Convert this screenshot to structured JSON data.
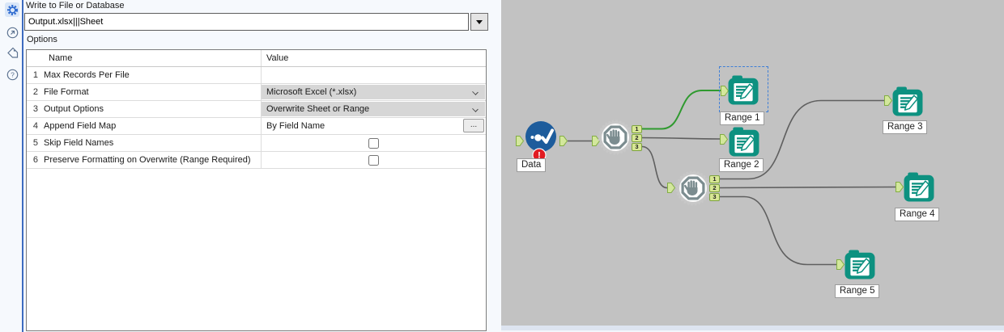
{
  "toolbar": {
    "icons": [
      {
        "name": "configuration-gear",
        "selected": true
      },
      {
        "name": "navigate-out",
        "selected": false
      },
      {
        "name": "annotation-tag",
        "selected": false
      },
      {
        "name": "help",
        "selected": false
      }
    ]
  },
  "config_panel": {
    "title": "Write to File or Database",
    "file_path": "Output.xlsx|||Sheet",
    "options_label": "Options",
    "table": {
      "columns": {
        "name": "Name",
        "value": "Value"
      },
      "rows": [
        {
          "num": "1",
          "name": "Max Records Per File",
          "value": "",
          "type": "text"
        },
        {
          "num": "2",
          "name": "File Format",
          "value": "Microsoft Excel (*.xlsx)",
          "type": "dropdown"
        },
        {
          "num": "3",
          "name": "Output Options",
          "value": "Overwrite Sheet or Range",
          "type": "dropdown"
        },
        {
          "num": "4",
          "name": "Append Field Map",
          "value": "By Field Name",
          "type": "button",
          "button_label": "..."
        },
        {
          "num": "5",
          "name": "Skip Field Names",
          "checked": false,
          "type": "checkbox"
        },
        {
          "num": "6",
          "name": "Preserve Formatting on Overwrite (Range Required)",
          "checked": false,
          "type": "checkbox"
        }
      ]
    }
  },
  "workflow": {
    "anchor_labels": [
      "1",
      "2",
      "3"
    ],
    "tools": [
      {
        "label": "Data",
        "type": "data-tool",
        "has_error_badge": true,
        "selected": false
      },
      {
        "label": "",
        "type": "block-until-done",
        "selected": false
      },
      {
        "label": "Range 1",
        "type": "output-data",
        "selected": true
      },
      {
        "label": "Range 2",
        "type": "output-data",
        "selected": false
      },
      {
        "label": "",
        "type": "block-until-done",
        "selected": false
      },
      {
        "label": "Range 3",
        "type": "output-data",
        "selected": false
      },
      {
        "label": "Range 4",
        "type": "output-data",
        "selected": false
      },
      {
        "label": "Range 5",
        "type": "output-data",
        "selected": false
      }
    ]
  },
  "colors": {
    "accent_blue": "#3d6cc0",
    "canvas_gray": "#c2c2c2",
    "tool_teal": "#0d9180",
    "tool_blue": "#1d5c9c",
    "anchor_fill": "#d8e795",
    "anchor_border": "#7da33e",
    "wire_gray": "#5f5f5f",
    "wire_selected_green": "#2f9a2f",
    "selection_blue": "#3f7fd6",
    "error_red": "#e11b22"
  }
}
